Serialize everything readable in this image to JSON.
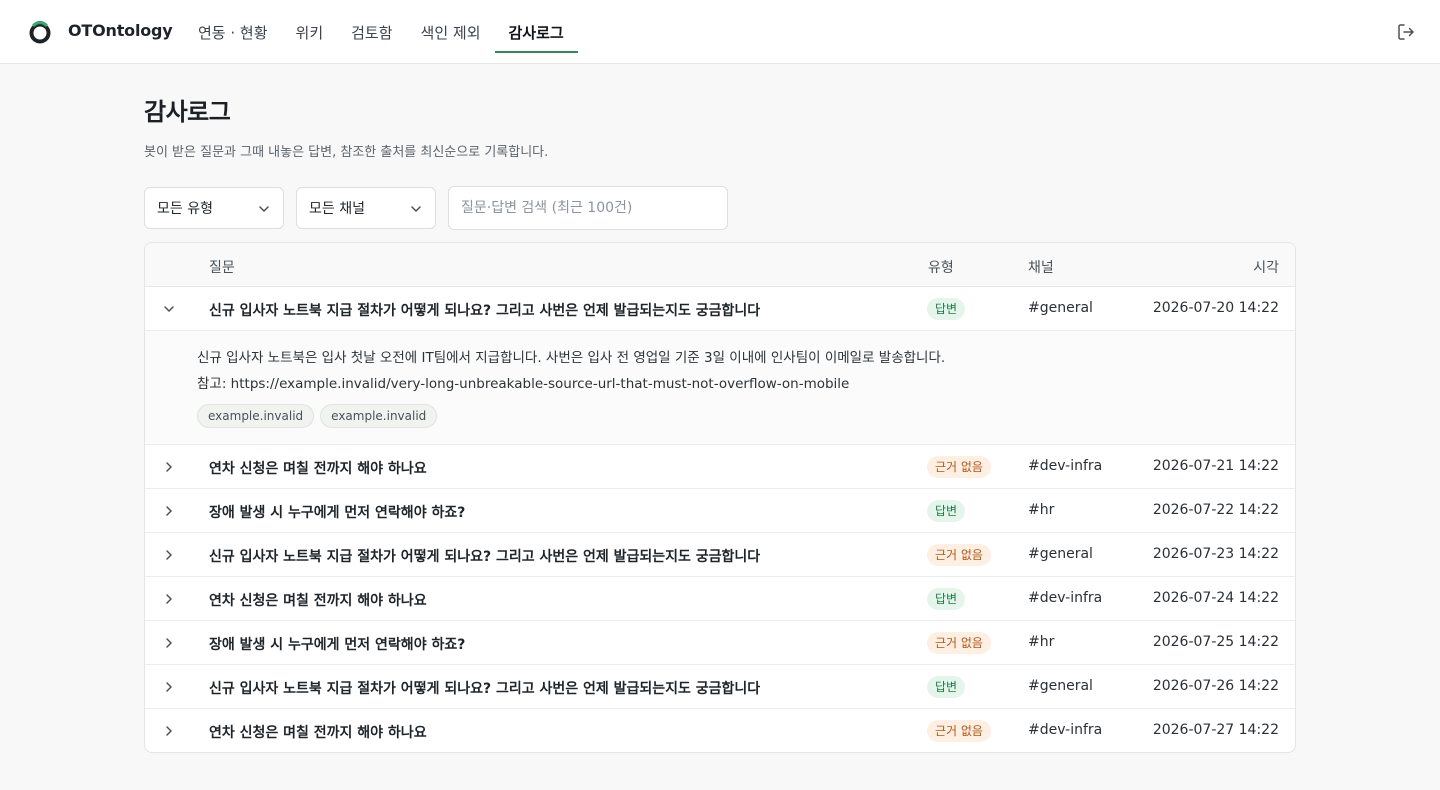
{
  "brand": {
    "name": "OTOntology"
  },
  "nav": [
    {
      "label": "연동 · 현황",
      "active": false
    },
    {
      "label": "위키",
      "active": false
    },
    {
      "label": "검토함",
      "active": false
    },
    {
      "label": "색인 제외",
      "active": false
    },
    {
      "label": "감사로그",
      "active": true
    }
  ],
  "page": {
    "title": "감사로그",
    "description": "봇이 받은 질문과 그때 내놓은 답변, 참조한 출처를 최신순으로 기록합니다."
  },
  "filters": {
    "type_label": "모든 유형",
    "channel_label": "모든 채널",
    "search_placeholder": "질문·답변 검색 (최근 100건)"
  },
  "table": {
    "headers": {
      "question": "질문",
      "type": "유형",
      "channel": "채널",
      "time": "시각"
    },
    "rows": [
      {
        "question": "신규 입사자 노트북 지급 절차가 어떻게 되나요? 그리고 사번은 언제 발급되는지도 궁금합니다",
        "type": "답변",
        "channel": "#general",
        "time": "2026-07-20 14:22",
        "expanded": true
      },
      {
        "question": "연차 신청은 며칠 전까지 해야 하나요",
        "type": "근거 없음",
        "channel": "#dev-infra",
        "time": "2026-07-21 14:22"
      },
      {
        "question": "장애 발생 시 누구에게 먼저 연락해야 하죠?",
        "type": "답변",
        "channel": "#hr",
        "time": "2026-07-22 14:22"
      },
      {
        "question": "신규 입사자 노트북 지급 절차가 어떻게 되나요? 그리고 사번은 언제 발급되는지도 궁금합니다",
        "type": "근거 없음",
        "channel": "#general",
        "time": "2026-07-23 14:22"
      },
      {
        "question": "연차 신청은 며칠 전까지 해야 하나요",
        "type": "답변",
        "channel": "#dev-infra",
        "time": "2026-07-24 14:22"
      },
      {
        "question": "장애 발생 시 누구에게 먼저 연락해야 하죠?",
        "type": "근거 없음",
        "channel": "#hr",
        "time": "2026-07-25 14:22"
      },
      {
        "question": "신규 입사자 노트북 지급 절차가 어떻게 되나요? 그리고 사번은 언제 발급되는지도 궁금합니다",
        "type": "답변",
        "channel": "#general",
        "time": "2026-07-26 14:22"
      },
      {
        "question": "연차 신청은 며칠 전까지 해야 하나요",
        "type": "근거 없음",
        "channel": "#dev-infra",
        "time": "2026-07-27 14:22"
      }
    ],
    "detail": {
      "answer": "신규 입사자 노트북은 입사 첫날 오전에 IT팀에서 지급합니다. 사번은 입사 전 영업일 기준 3일 이내에 인사팀이 이메일로 발송합니다.",
      "reference": "참고: https://example.invalid/very-long-unbreakable-source-url-that-must-not-overflow-on-mobile",
      "sources": [
        "example.invalid",
        "example.invalid"
      ]
    }
  },
  "colors": {
    "accent": "#2f8a5a",
    "badge_answer_bg": "#e6f5ec",
    "badge_answer_fg": "#1e7a4a",
    "badge_nosource_bg": "#fdf0e2",
    "badge_nosource_fg": "#b5561a"
  },
  "icons": {
    "logo": "ring-logo-icon",
    "logout": "logout-icon",
    "dropdown": "chevron-down-icon",
    "row_expanded": "chevron-down-icon",
    "row_collapsed": "chevron-right-icon"
  }
}
